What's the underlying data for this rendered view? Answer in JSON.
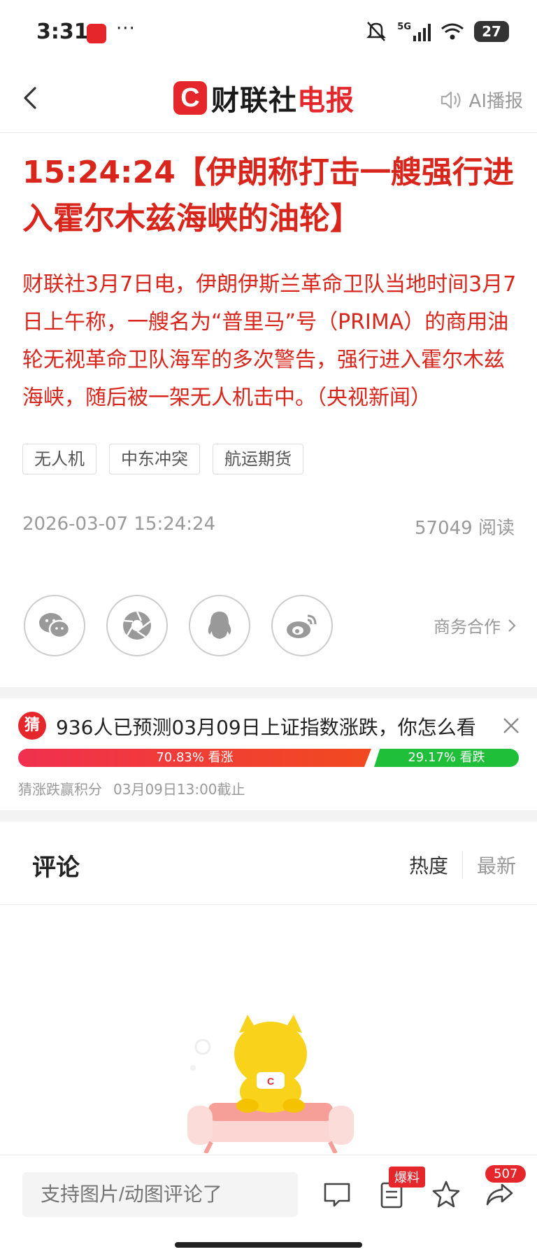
{
  "status_bar": {
    "time": "3:31",
    "dots": "···",
    "network": "5G",
    "battery": "27"
  },
  "nav": {
    "logo_letter": "C",
    "logo_black": "财联社",
    "logo_red": "电报",
    "ai_play": "AI播报"
  },
  "article": {
    "headline": "15:24:24【伊朗称打击一艘强行进入霍尔木兹海峡的油轮】",
    "body": "财联社3月7日电，伊朗伊斯兰革命卫队当地时间3月7日上午称，一艘名为“普里马”号（PRIMA）的商用油轮无视革命卫队海军的多次警告，强行进入霍尔木兹海峡，随后被一架无人机击中。（央视新闻）",
    "tags": [
      "无人机",
      "中东冲突",
      "航运期货"
    ],
    "date": "2026-03-07 15:24:24",
    "reads": "57049 阅读"
  },
  "share": {
    "business": "商务合作"
  },
  "prediction": {
    "badge": "猜",
    "title": "936人已预测03月09日上证指数涨跌，你怎么看",
    "up_label": "70.83% 看涨",
    "down_label": "29.17% 看跌",
    "up_fraction": 0.7083,
    "footer_left": "猜涨跌赢积分",
    "footer_right": "03月09日13:00截止"
  },
  "comments": {
    "title": "评论",
    "sort_hot": "热度",
    "sort_new": "最新"
  },
  "bottom_bar": {
    "placeholder": "支持图片/动图评论了",
    "baoliao": "爆料",
    "share_count": "507"
  },
  "colors": {
    "brand_red": "#e5262b",
    "headline_red": "#d9261c",
    "up": "#f0304e",
    "down": "#1fbf3a"
  }
}
